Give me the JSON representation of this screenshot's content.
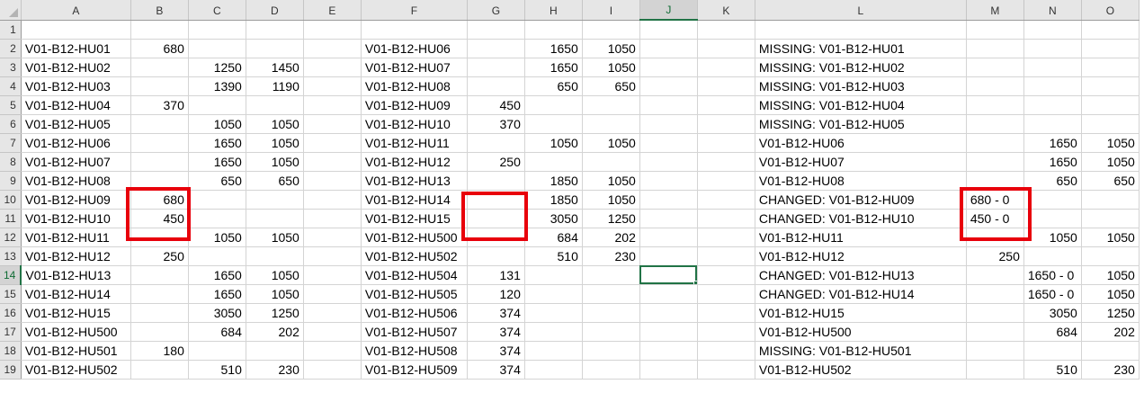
{
  "columns": [
    "",
    "A",
    "B",
    "C",
    "D",
    "E",
    "F",
    "G",
    "H",
    "I",
    "J",
    "K",
    "L",
    "M",
    "N",
    "O"
  ],
  "active_column": "J",
  "active_row": "14",
  "accent_color": "#217346",
  "highlight_color": "#e8000b",
  "rows": [
    {
      "n": "1",
      "c": [
        "",
        "",
        "",
        "",
        "",
        "",
        "",
        "",
        "",
        "",
        "",
        "",
        "",
        "",
        ""
      ]
    },
    {
      "n": "2",
      "c": [
        "V01-B12-HU01",
        "680",
        "",
        "",
        "",
        "V01-B12-HU06",
        "",
        "1650",
        "1050",
        "",
        "",
        "MISSING: V01-B12-HU01",
        "",
        "",
        ""
      ]
    },
    {
      "n": "3",
      "c": [
        "V01-B12-HU02",
        "",
        "1250",
        "1450",
        "",
        "V01-B12-HU07",
        "",
        "1650",
        "1050",
        "",
        "",
        "MISSING: V01-B12-HU02",
        "",
        "",
        ""
      ]
    },
    {
      "n": "4",
      "c": [
        "V01-B12-HU03",
        "",
        "1390",
        "1190",
        "",
        "V01-B12-HU08",
        "",
        "650",
        "650",
        "",
        "",
        "MISSING: V01-B12-HU03",
        "",
        "",
        ""
      ]
    },
    {
      "n": "5",
      "c": [
        "V01-B12-HU04",
        "370",
        "",
        "",
        "",
        "V01-B12-HU09",
        "450",
        "",
        "",
        "",
        "",
        "MISSING: V01-B12-HU04",
        "",
        "",
        ""
      ]
    },
    {
      "n": "6",
      "c": [
        "V01-B12-HU05",
        "",
        "1050",
        "1050",
        "",
        "V01-B12-HU10",
        "370",
        "",
        "",
        "",
        "",
        "MISSING: V01-B12-HU05",
        "",
        "",
        ""
      ]
    },
    {
      "n": "7",
      "c": [
        "V01-B12-HU06",
        "",
        "1650",
        "1050",
        "",
        "V01-B12-HU11",
        "",
        "1050",
        "1050",
        "",
        "",
        "V01-B12-HU06",
        "",
        "1650",
        "1050"
      ]
    },
    {
      "n": "8",
      "c": [
        "V01-B12-HU07",
        "",
        "1650",
        "1050",
        "",
        "V01-B12-HU12",
        "250",
        "",
        "",
        "",
        "",
        "V01-B12-HU07",
        "",
        "1650",
        "1050"
      ]
    },
    {
      "n": "9",
      "c": [
        "V01-B12-HU08",
        "",
        "650",
        "650",
        "",
        "V01-B12-HU13",
        "",
        "1850",
        "1050",
        "",
        "",
        "V01-B12-HU08",
        "",
        "650",
        "650"
      ]
    },
    {
      "n": "10",
      "c": [
        "V01-B12-HU09",
        "680",
        "",
        "",
        "",
        "V01-B12-HU14",
        "",
        "1850",
        "1050",
        "",
        "",
        "CHANGED: V01-B12-HU09",
        "680 - 0",
        "",
        ""
      ]
    },
    {
      "n": "11",
      "c": [
        "V01-B12-HU10",
        "450",
        "",
        "",
        "",
        "V01-B12-HU15",
        "",
        "3050",
        "1250",
        "",
        "",
        "CHANGED: V01-B12-HU10",
        "450 - 0",
        "",
        ""
      ]
    },
    {
      "n": "12",
      "c": [
        "V01-B12-HU11",
        "",
        "1050",
        "1050",
        "",
        "V01-B12-HU500",
        "",
        "684",
        "202",
        "",
        "",
        "V01-B12-HU11",
        "",
        "1050",
        "1050"
      ]
    },
    {
      "n": "13",
      "c": [
        "V01-B12-HU12",
        "250",
        "",
        "",
        "",
        "V01-B12-HU502",
        "",
        "510",
        "230",
        "",
        "",
        "V01-B12-HU12",
        "250",
        "",
        ""
      ]
    },
    {
      "n": "14",
      "c": [
        "V01-B12-HU13",
        "",
        "1650",
        "1050",
        "",
        "V01-B12-HU504",
        "131",
        "",
        "",
        "",
        "",
        "CHANGED: V01-B12-HU13",
        "",
        "1650 - 0",
        "1050"
      ]
    },
    {
      "n": "15",
      "c": [
        "V01-B12-HU14",
        "",
        "1650",
        "1050",
        "",
        "V01-B12-HU505",
        "120",
        "",
        "",
        "",
        "",
        "CHANGED: V01-B12-HU14",
        "",
        "1650 - 0",
        "1050"
      ]
    },
    {
      "n": "16",
      "c": [
        "V01-B12-HU15",
        "",
        "3050",
        "1250",
        "",
        "V01-B12-HU506",
        "374",
        "",
        "",
        "",
        "",
        "V01-B12-HU15",
        "",
        "3050",
        "1250"
      ]
    },
    {
      "n": "17",
      "c": [
        "V01-B12-HU500",
        "",
        "684",
        "202",
        "",
        "V01-B12-HU507",
        "374",
        "",
        "",
        "",
        "",
        "V01-B12-HU500",
        "",
        "684",
        "202"
      ]
    },
    {
      "n": "18",
      "c": [
        "V01-B12-HU501",
        "180",
        "",
        "",
        "",
        "V01-B12-HU508",
        "374",
        "",
        "",
        "",
        "",
        "MISSING: V01-B12-HU501",
        "",
        "",
        ""
      ]
    },
    {
      "n": "19",
      "c": [
        "V01-B12-HU502",
        "",
        "510",
        "230",
        "",
        "V01-B12-HU509",
        "374",
        "",
        "",
        "",
        "",
        "V01-B12-HU502",
        "",
        "510",
        "230"
      ]
    }
  ]
}
